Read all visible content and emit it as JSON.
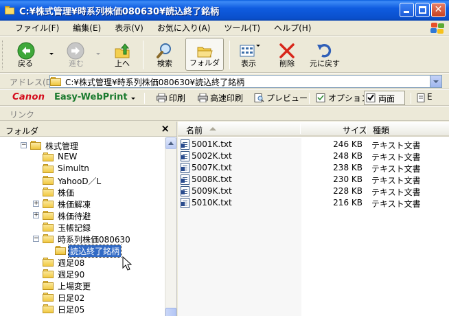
{
  "window": {
    "title": "C:¥株式管理¥時系列株価080630¥読込終了銘柄"
  },
  "menu": {
    "items": [
      "ファイル(F)",
      "編集(E)",
      "表示(V)",
      "お気に入り(A)",
      "ツール(T)",
      "ヘルプ(H)"
    ]
  },
  "toolbar": {
    "back": "戻る",
    "forward": "進む",
    "up": "上へ",
    "search": "検索",
    "folders": "フォルダ",
    "views": "表示",
    "delete": "削除",
    "undo": "元に戻す"
  },
  "address": {
    "label": "アドレス(D)",
    "value": "C:¥株式管理¥時系列株価080630¥読込終了銘柄"
  },
  "canon_bar": {
    "brand": "Canon",
    "product": "Easy-WebPrint",
    "print": "印刷",
    "hq_print": "高速印刷",
    "preview": "プレビュー",
    "options": "オプション",
    "duplex": "両面",
    "truncated": "E"
  },
  "links": {
    "label": "リンク"
  },
  "folder_pane": {
    "title": "フォルダ",
    "close": "×",
    "tree": [
      {
        "label": "株式管理",
        "expander": "−",
        "open": true
      },
      {
        "label": "NEW"
      },
      {
        "label": "Simultn"
      },
      {
        "label": "YahooD／L"
      },
      {
        "label": "株価"
      },
      {
        "label": "株価解凍",
        "expander": "+"
      },
      {
        "label": "株価待避",
        "expander": "+"
      },
      {
        "label": "玉帳記録"
      },
      {
        "label": "時系列株価080630",
        "expander": "−",
        "open": true
      },
      {
        "label": "読込終了銘柄",
        "selected": true
      },
      {
        "label": "週足08"
      },
      {
        "label": "週足90"
      },
      {
        "label": "上場変更"
      },
      {
        "label": "日足02"
      },
      {
        "label": "日足05"
      }
    ]
  },
  "file_list": {
    "columns": {
      "name": "名前",
      "size": "サイズ",
      "type": "種類"
    },
    "rows": [
      {
        "name": "5001K.txt",
        "size": "246 KB",
        "type": "テキスト文書"
      },
      {
        "name": "5002K.txt",
        "size": "248 KB",
        "type": "テキスト文書"
      },
      {
        "name": "5007K.txt",
        "size": "238 KB",
        "type": "テキスト文書"
      },
      {
        "name": "5008K.txt",
        "size": "230 KB",
        "type": "テキスト文書"
      },
      {
        "name": "5009K.txt",
        "size": "228 KB",
        "type": "テキスト文書"
      },
      {
        "name": "5010K.txt",
        "size": "216 KB",
        "type": "テキスト文書"
      }
    ]
  },
  "colors": {
    "titlebar": "#0A4FCB",
    "selection": "#316AC5",
    "canon_red": "#D40A1A",
    "ewp_green": "#1A7A2E"
  }
}
